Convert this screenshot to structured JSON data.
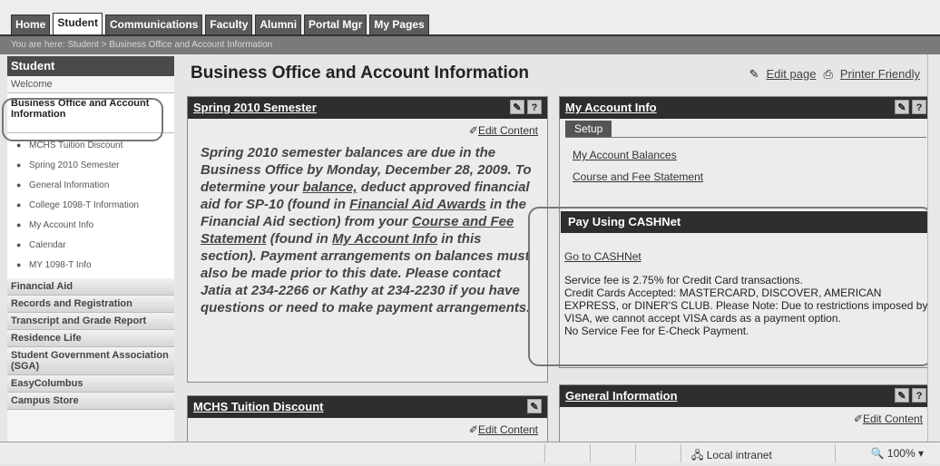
{
  "tabs": [
    "Home",
    "Student",
    "Communications",
    "Faculty",
    "Alumni",
    "Portal Mgr",
    "My Pages"
  ],
  "breadcrumb": "You are here:  Student > Business Office and Account Information",
  "sidebar": {
    "title": "Student",
    "welcome": "Welcome",
    "current": "Business Office and Account Information",
    "sub_items": [
      "MCHS Tuition Discount",
      "Spring 2010 Semester",
      "General Information",
      "College 1098-T Information",
      "My Account Info",
      "Calendar",
      "MY 1098-T Info"
    ],
    "items": [
      "Financial Aid",
      "Records and Registration",
      "Transcript and Grade Report",
      "Residence Life",
      "Student Government Association (SGA)",
      "EasyColumbus",
      "Campus Store"
    ]
  },
  "page": {
    "title": "Business Office and Account Information",
    "edit_page": "Edit page",
    "printer_friendly": "Printer Friendly"
  },
  "spring": {
    "title": "Spring 2010 Semester",
    "edit": "Edit Content",
    "t1": "Spring 2010 semester balances are due in the Business Office by Monday, December 28, 2009. To determine your ",
    "l1": "balance,",
    "t2": " deduct approved financial aid for SP-10 (found in ",
    "l2": "Financial Aid Awards",
    "t3": " in the Financial Aid section) from your ",
    "l3": "Course and Fee Statement",
    "t4": " (found in ",
    "l4": "My Account Info",
    "t5": " in this section). Payment arrangements on balances must also be made prior to this date. Please contact Jatia at 234-2266 or Kathy at 234-2230 if you have questions or need to make payment arrangements."
  },
  "mchs": {
    "title": "MCHS Tuition Discount",
    "edit": "Edit Content"
  },
  "account": {
    "title": "My Account Info",
    "setup": "Setup",
    "links": [
      "My Account Balances",
      "Course and Fee Statement"
    ]
  },
  "cashnet": {
    "title": "Pay Using CASHNet",
    "link": "Go to CASHNet",
    "lines": [
      "Service fee is 2.75% for Credit Card transactions.",
      "Credit Cards Accepted: MASTERCARD, DISCOVER, AMERICAN EXPRESS, or DINER'S CLUB. Please Note: Due to restrictions imposed by VISA, we cannot accept VISA cards as a payment option.",
      "No Service Fee for E-Check Payment."
    ]
  },
  "general": {
    "title": "General Information",
    "edit": "Edit Content"
  },
  "status": {
    "zone": "Local intranet",
    "zoom": "100%"
  }
}
